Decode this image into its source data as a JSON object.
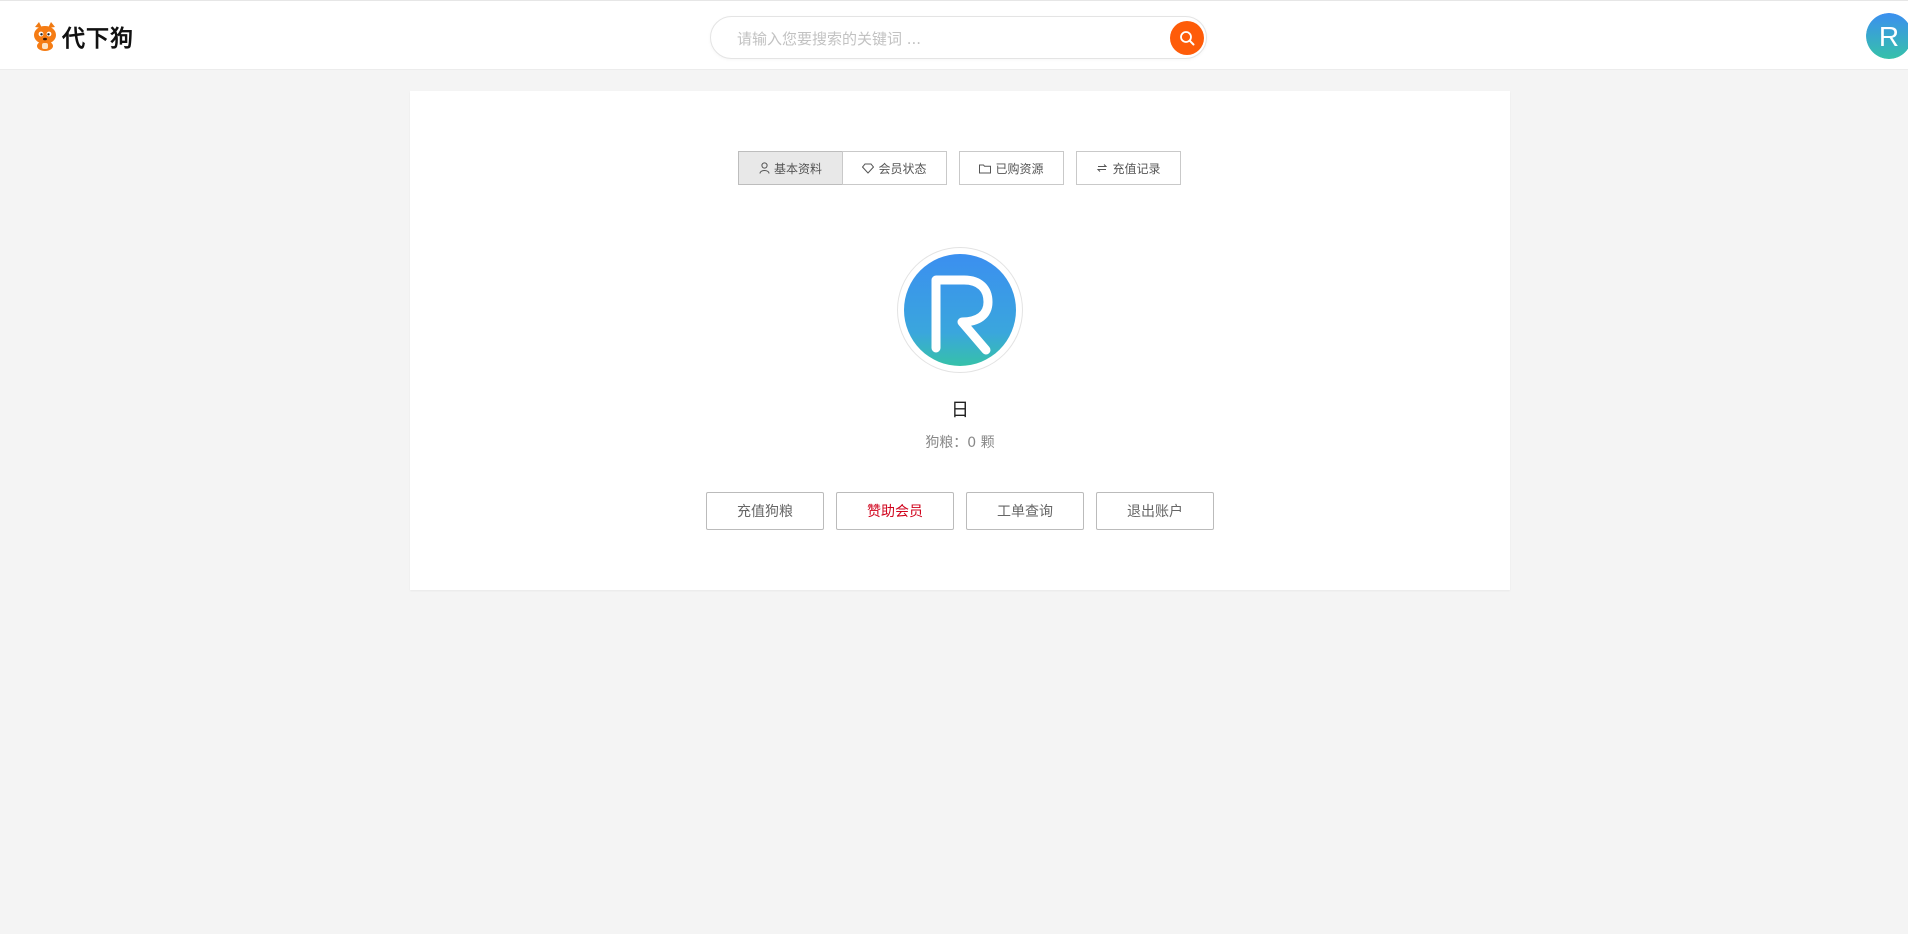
{
  "header": {
    "logo_text": "代下狗",
    "logo_icon": "cartoon-dog-logo",
    "search_placeholder": "请输入您要搜索的关键词 ...",
    "search_icon": "search-icon",
    "accent_color": "#fe5c09"
  },
  "tabs": [
    {
      "label": "基本资料",
      "icon": "user-icon",
      "active": true
    },
    {
      "label": "会员状态",
      "icon": "diamond-icon",
      "active": false
    },
    {
      "label": "已购资源",
      "icon": "folder-icon",
      "active": false
    },
    {
      "label": "充值记录",
      "icon": "transfer-icon",
      "active": false
    }
  ],
  "profile": {
    "avatar_letter": "R",
    "username": "日",
    "points_text": "狗粮：0 颗"
  },
  "actions": [
    {
      "label": "充值狗粮",
      "color": "#666666"
    },
    {
      "label": "赞助会员",
      "color": "#d0021b"
    },
    {
      "label": "工单查询",
      "color": "#666666"
    },
    {
      "label": "退出账户",
      "color": "#666666"
    }
  ],
  "colors": {
    "avatar_gradient_top": "#3b8ff0",
    "avatar_gradient_bottom": "#36c1a9",
    "page_bg": "#f4f4f4"
  }
}
